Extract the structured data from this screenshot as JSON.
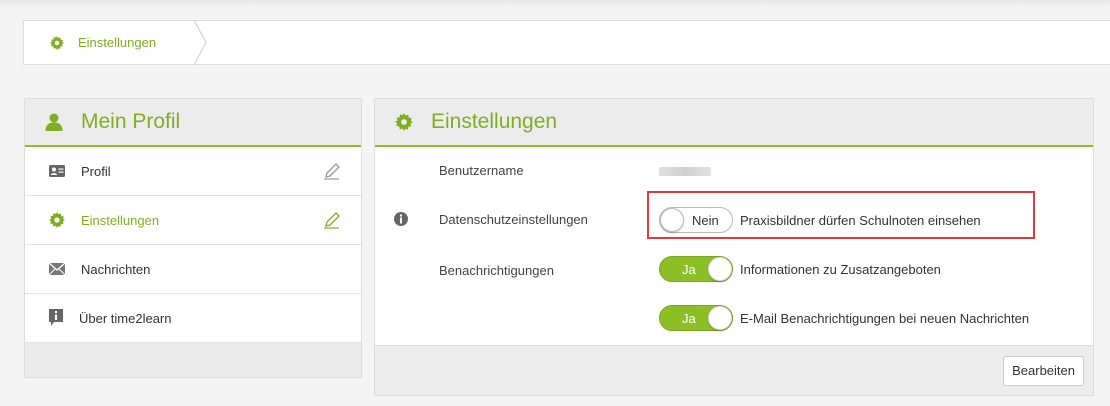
{
  "breadcrumb": {
    "label": "Einstellungen",
    "icon": "gear-icon"
  },
  "profile_panel": {
    "title": "Mein Profil",
    "icon": "user-icon",
    "items": [
      {
        "label": "Profil",
        "icon": "id-card-icon",
        "editable": true,
        "active": false
      },
      {
        "label": "Einstellungen",
        "icon": "gear-icon",
        "editable": true,
        "active": true
      },
      {
        "label": "Nachrichten",
        "icon": "envelope-icon",
        "editable": false,
        "active": false
      },
      {
        "label": "Über time2learn",
        "icon": "info-icon",
        "editable": false,
        "active": false
      }
    ]
  },
  "settings_panel": {
    "title": "Einstellungen",
    "icon": "gear-icon",
    "username_label": "Benutzername",
    "privacy": {
      "label": "Datenschutzeinstellungen",
      "toggle_text": "Nein",
      "toggle_state": "off",
      "description": "Praxisbildner dürfen Schulnoten einsehen"
    },
    "notifications": {
      "label": "Benachrichtigungen",
      "items": [
        {
          "toggle_text": "Ja",
          "toggle_state": "on",
          "description": "Informationen zu Zusatzangeboten"
        },
        {
          "toggle_text": "Ja",
          "toggle_state": "on",
          "description": "E-Mail Benachrichtigungen bei neuen Nachrichten"
        }
      ]
    },
    "edit_button": "Bearbeiten"
  },
  "colors": {
    "accent": "#8cbf26",
    "accent_text": "#7fae22",
    "highlight": "#e03a3a"
  }
}
